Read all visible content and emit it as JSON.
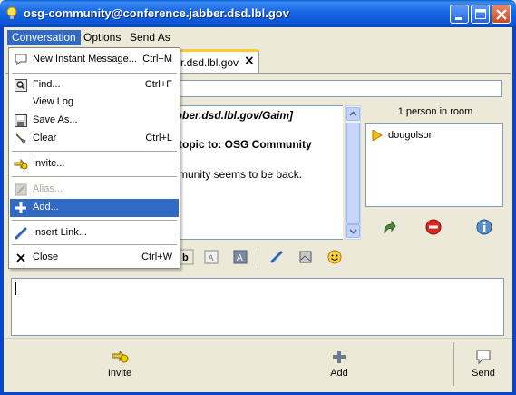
{
  "window": {
    "title": "osg-community@conference.jabber.dsd.lbl.gov"
  },
  "menubar": {
    "conversation": "Conversation",
    "options": "Options",
    "send_as": "Send As"
  },
  "tab": {
    "label": "r.dsd.lbl.gov",
    "close": "×"
  },
  "chat": {
    "line1": "abber.dsd.lbl.gov/Gaim]",
    "line2": "e topic to: OSG Community",
    "line3": "mmunity seems to be back."
  },
  "room": {
    "count": "1 person in room",
    "users": [
      "dougolson"
    ]
  },
  "dropdown": {
    "items": [
      {
        "label": "New Instant Message...",
        "shortcut": "Ctrl+M",
        "icon": "chat-bubble-icon"
      },
      {
        "label": "Find...",
        "shortcut": "Ctrl+F",
        "icon": "find-icon"
      },
      {
        "label": "View Log",
        "shortcut": "",
        "icon": ""
      },
      {
        "label": "Save As...",
        "shortcut": "",
        "icon": "save-icon"
      },
      {
        "label": "Clear",
        "shortcut": "Ctrl+L",
        "icon": "broom-icon"
      },
      {
        "label": "Invite...",
        "shortcut": "",
        "icon": "invite-icon"
      },
      {
        "label": "Alias...",
        "shortcut": "",
        "icon": "alias-icon"
      },
      {
        "label": "Add...",
        "shortcut": "",
        "icon": "add-icon"
      },
      {
        "label": "Insert Link...",
        "shortcut": "",
        "icon": "link-icon"
      },
      {
        "label": "Close",
        "shortcut": "Ctrl+W",
        "icon": "close-icon"
      }
    ]
  },
  "bottom_bar": {
    "invite": "Invite",
    "add": "Add",
    "send": "Send"
  },
  "colors": {
    "titlebar": "#0a56d6",
    "menu_highlight": "#316ac5",
    "panel": "#ece9d8"
  }
}
